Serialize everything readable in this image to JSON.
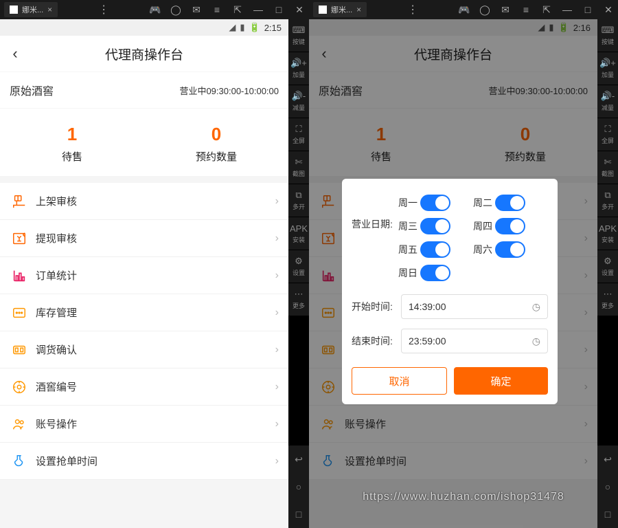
{
  "emulator": {
    "tab_title": "娜米...",
    "side_tools": [
      {
        "icon": "⌨",
        "label": "按键"
      },
      {
        "icon": "🔊+",
        "label": "加量"
      },
      {
        "icon": "🔊-",
        "label": "减量"
      },
      {
        "icon": "⛶",
        "label": "全屏"
      },
      {
        "icon": "✄",
        "label": "截图"
      },
      {
        "icon": "⧉",
        "label": "多开"
      },
      {
        "icon": "APK",
        "label": "安装"
      },
      {
        "icon": "⚙",
        "label": "设置"
      },
      {
        "icon": "⋯",
        "label": "更多"
      }
    ],
    "nav_buttons": [
      "↩",
      "○",
      "□"
    ]
  },
  "status": {
    "time_left": "2:15",
    "time_right": "2:16"
  },
  "header": {
    "title": "代理商操作台"
  },
  "store": {
    "name": "原始酒窖",
    "hours": "营业中09:30:00-10:00:00"
  },
  "stats": [
    {
      "value": "1",
      "label": "待售"
    },
    {
      "value": "0",
      "label": "预约数量"
    }
  ],
  "menu": [
    {
      "key": "shelf-audit",
      "label": "上架审核",
      "color": "#ff6600"
    },
    {
      "key": "withdraw-audit",
      "label": "提现审核",
      "color": "#ff6600"
    },
    {
      "key": "order-stats",
      "label": "订单统计",
      "color": "#e91e63"
    },
    {
      "key": "inventory",
      "label": "库存管理",
      "color": "#ff9800"
    },
    {
      "key": "transfer-confirm",
      "label": "调货确认",
      "color": "#ff9800"
    },
    {
      "key": "cellar-number",
      "label": "酒窖编号",
      "color": "#ff9800"
    },
    {
      "key": "account-ops",
      "label": "账号操作",
      "color": "#ff9800"
    },
    {
      "key": "grab-time",
      "label": "设置抢单时间",
      "color": "#2196f3"
    }
  ],
  "dialog": {
    "business_date_label": "营业日期:",
    "days": [
      "周一",
      "周二",
      "周三",
      "周四",
      "周五",
      "周六",
      "周日"
    ],
    "start_label": "开始时间:",
    "start_value": "14:39:00",
    "end_label": "结束时间:",
    "end_value": "23:59:00",
    "cancel": "取消",
    "ok": "确定"
  },
  "watermark": "https://www.huzhan.com/ishop31478"
}
